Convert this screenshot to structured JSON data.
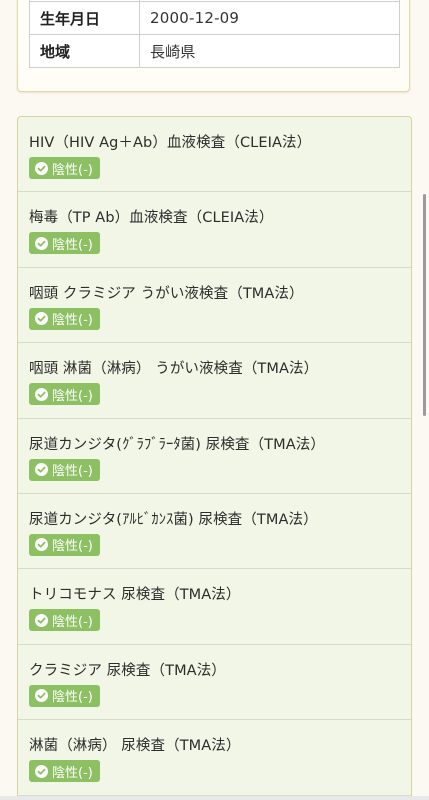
{
  "profile": {
    "rows": [
      {
        "label": "",
        "value": ""
      },
      {
        "label": "生年月日",
        "value": "2000-12-09"
      },
      {
        "label": "地域",
        "value": "長崎県"
      }
    ]
  },
  "results": [
    {
      "name": "HIV（HIV Ag＋Ab）血液検査（CLEIA法）",
      "status": "陰性(-)",
      "icon": "check-circle-icon"
    },
    {
      "name": "梅毒（TP Ab）血液検査（CLEIA法）",
      "status": "陰性(-)",
      "icon": "check-circle-icon"
    },
    {
      "name": "咽頭 クラミジア うがい液検査（TMA法）",
      "status": "陰性(-)",
      "icon": "check-circle-icon"
    },
    {
      "name": "咽頭 淋菌（淋病） うがい液検査（TMA法）",
      "status": "陰性(-)",
      "icon": "check-circle-icon"
    },
    {
      "name": "尿道カンジタ(ｸﾞﾗﾌﾞﾗｰﾀ菌) 尿検査（TMA法）",
      "status": "陰性(-)",
      "icon": "check-circle-icon"
    },
    {
      "name": "尿道カンジタ(ｱﾙﾋﾞｶﾝｽ菌) 尿検査（TMA法）",
      "status": "陰性(-)",
      "icon": "check-circle-icon"
    },
    {
      "name": "トリコモナス 尿検査（TMA法）",
      "status": "陰性(-)",
      "icon": "check-circle-icon"
    },
    {
      "name": "クラミジア 尿検査（TMA法）",
      "status": "陰性(-)",
      "icon": "check-circle-icon"
    },
    {
      "name": "淋菌（淋病） 尿検査（TMA法）",
      "status": "陰性(-)",
      "icon": "check-circle-icon"
    }
  ],
  "colors": {
    "badge_negative": "#8cc063",
    "list_background": "#f1f6e6",
    "card_border": "#d9d2a6"
  }
}
